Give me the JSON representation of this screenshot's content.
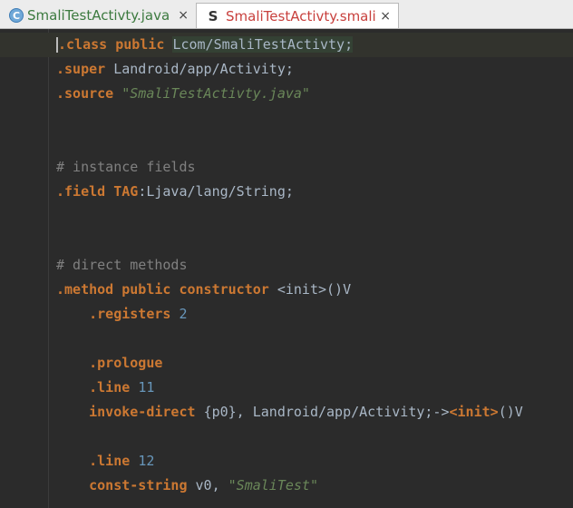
{
  "tabs": [
    {
      "label": "SmaliTestActivty.java",
      "icon": "c-class-icon",
      "close": "×"
    },
    {
      "label": "SmaliTestActivty.smali",
      "icon": "s-smali-icon",
      "close": "×"
    }
  ],
  "icons": {
    "java": "C",
    "smali": "S"
  },
  "code": {
    "l1_dot": ".",
    "l1_kw": "class public",
    "l1_cls": "Lcom/SmaliTestActivty;",
    "l2_kw": ".super",
    "l2_cls": "Landroid/app/Activity;",
    "l3_kw": ".source",
    "l3_str": "\"SmaliTestActivty.java\"",
    "l4_cmt": "# instance fields",
    "l5_kw": ".field",
    "l5_name": "TAG",
    "l5_cls": ":Ljava/lang/String;",
    "l6_cmt": "# direct methods",
    "l7_kw": ".method public constructor",
    "l7_sig": "<init>()V",
    "l8_kw": ".registers",
    "l8_num": "2",
    "l9_kw": ".prologue",
    "l10_kw": ".line",
    "l10_num": "11",
    "l11_kw": "invoke-direct",
    "l11_rest": "{p0}, Landroid/app/Activity;->",
    "l11_init": "<init>",
    "l11_tail": "()V",
    "l12_kw": ".line",
    "l12_num": "12",
    "l13_kw": "const-string",
    "l13_reg": "v0,",
    "l13_str": "\"SmaliTest\""
  }
}
